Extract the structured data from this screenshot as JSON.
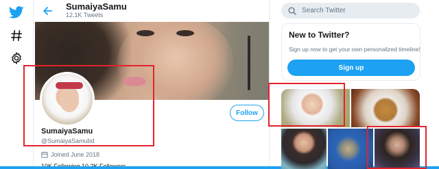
{
  "nav": {
    "icons": [
      "twitter-logo",
      "hashtag-icon",
      "gear-icon"
    ]
  },
  "header": {
    "name": "SumaiyaSamu",
    "tweet_count": "12.1K Tweets"
  },
  "profile": {
    "display_name": "SumaiyaSamu",
    "handle": "@SumaiyaSamubd",
    "joined": "Joined June 2018",
    "follow_label": "Follow",
    "stats_text": "10K Following  10.2K Followers"
  },
  "search": {
    "placeholder": "Search Twitter"
  },
  "new_to_twitter": {
    "title": "New to Twitter?",
    "description": "Sign up now to get your own personalized timeline!",
    "signup_label": "Sign up"
  },
  "colors": {
    "accent": "#1da1f2",
    "annotation": "#e3222a"
  }
}
